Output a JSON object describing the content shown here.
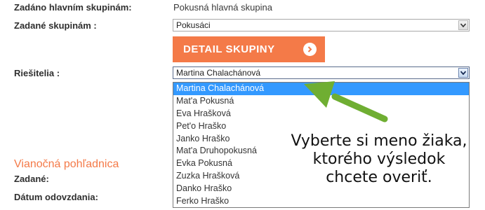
{
  "form": {
    "main_group_label": "Zadáno hlavním skupinám:",
    "main_group_value": "Pokusná hlavná skupina",
    "groups_label": "Zadané skupinám :",
    "groups_value": "Pokusáci",
    "detail_button": "DETAIL SKUPINY",
    "solvers_label": "Riešitelia :",
    "solvers_value": "Martina Chalachánová"
  },
  "dropdown": {
    "options": [
      "Martina Chalachánová",
      "Mat'a Pokusná",
      "Eva Hrašková",
      "Pet'o Hraško",
      "Janko Hraško",
      "Mat'a Druhopokusná",
      "Evka Pokusná",
      "Zuzka Hrašková",
      "Danko Hraško",
      "Ferko Hraško"
    ],
    "selected_index": 0
  },
  "section": {
    "title": "Vianočná pohľadnica",
    "assigned_label": "Zadané:",
    "deadline_label": "Dátum odovzdania:"
  },
  "callout": {
    "line1": "Vyberte si meno žiaka,",
    "line2": "ktorého výsledok",
    "line3": "chcete overiť."
  },
  "colors": {
    "accent": "#f47a48",
    "selection": "#3399ff",
    "arrow": "#6fae32"
  }
}
